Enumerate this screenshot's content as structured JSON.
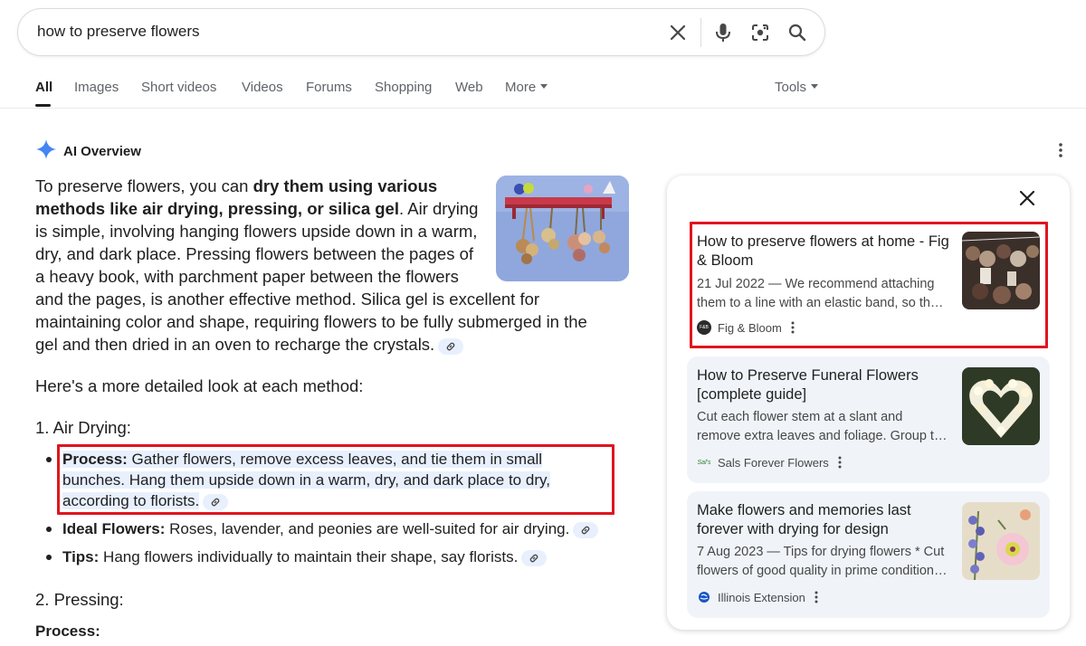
{
  "search": {
    "query": "how to preserve flowers"
  },
  "tabs": [
    "All",
    "Images",
    "Short videos",
    "Videos",
    "Forums",
    "Shopping",
    "Web",
    "More"
  ],
  "tools_label": "Tools",
  "ai_overview": {
    "title": "AI Overview",
    "intro_before": "To preserve flowers, you can ",
    "intro_bold": "dry them using various methods like air drying, pressing, or silica gel",
    "intro_after": ". Air drying is simple, involving hanging flowers upside down in a warm, dry, and dark place. Pressing flowers between the pages of a heavy book, with parchment paper between the flowers and the pages, is another effective method. Silica gel is ex­cellent for maintaining color and shape, requiring flowers to be fully sub­merged in the gel and then dried in an oven to recharge the crystals.",
    "detail_intro": "Here's a more detailed look at each method:",
    "section1": "1. Air Drying:",
    "bullets": [
      {
        "label": "Process:",
        "text": " Gather flowers, remove excess leaves, and tie them in small bunches. Hang them upside down in a warm, dry, and dark place to dry, according to florists."
      },
      {
        "label": "Ideal Flowers:",
        "text": " Roses, lavender, and peonies are well-suited for air drying."
      },
      {
        "label": "Tips:",
        "text": " Hang flowers individually to maintain their shape, say florists."
      }
    ],
    "section2": "2. Pressing:",
    "section2_sub": "Process:"
  },
  "sources": [
    {
      "title": "How to preserve flowers at home - Fig & Bloom",
      "snippet_line1": "21 Jul 2022 — We recommend attaching",
      "snippet_line2": "them to a line with an elastic band, so th…",
      "source": "Fig & Bloom",
      "favicon_text": "F&B"
    },
    {
      "title": "How to Preserve Funeral Flowers [complete guide]",
      "snippet_line1": "Cut each flower stem at a slant and",
      "snippet_line2": "remove extra leaves and foliage. Group t…",
      "source": "Sals Forever Flowers",
      "favicon_text": "Sal's"
    },
    {
      "title": "Make flowers and memories last forever with drying for design",
      "snippet_line1": "7 Aug 2023 — Tips for drying flowers * Cut",
      "snippet_line2": "flowers of good quality in prime condition…",
      "source": "Illinois Extension",
      "favicon_text": ""
    }
  ],
  "colors": {
    "highlight_box": "#e0141e",
    "chip": "#e8f0fe",
    "card_bg": "#f0f4f9",
    "ai_star": "#4285f4"
  }
}
